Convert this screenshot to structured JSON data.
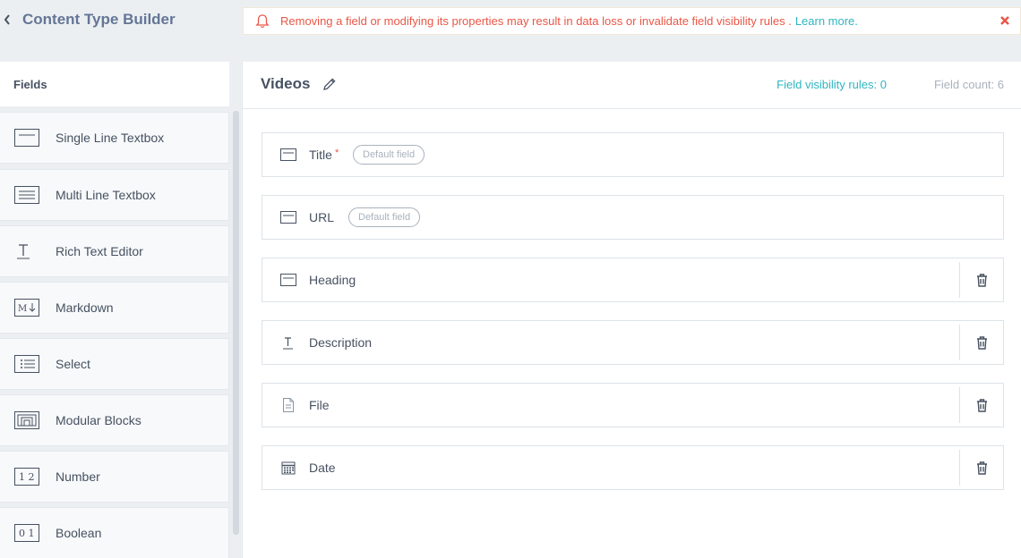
{
  "header": {
    "title": "Content Type Builder"
  },
  "alert": {
    "message": "Removing a field or modifying its properties may result in data loss or invalidate field visibility rules .",
    "link_label": "Learn more."
  },
  "sidebar": {
    "title": "Fields",
    "field_types": [
      {
        "label": "Single Line Textbox",
        "icon": "single-line-icon"
      },
      {
        "label": "Multi Line Textbox",
        "icon": "multi-line-icon"
      },
      {
        "label": "Rich Text Editor",
        "icon": "rich-text-icon"
      },
      {
        "label": "Markdown",
        "icon": "markdown-icon"
      },
      {
        "label": "Select",
        "icon": "select-list-icon"
      },
      {
        "label": "Modular Blocks",
        "icon": "modular-blocks-icon"
      },
      {
        "label": "Number",
        "icon": "number-icon"
      },
      {
        "label": "Boolean",
        "icon": "boolean-icon"
      }
    ]
  },
  "main": {
    "content_type_name": "Videos",
    "visibility_rules": "Field visibility rules: 0",
    "field_count": "Field count: 6",
    "fields": [
      {
        "label": "Title",
        "required_mark": "*",
        "badge": "Default field",
        "icon": "single-line-icon"
      },
      {
        "label": "URL",
        "badge": "Default field",
        "icon": "single-line-icon"
      },
      {
        "label": "Heading",
        "icon": "single-line-icon"
      },
      {
        "label": "Description",
        "icon": "rich-text-icon"
      },
      {
        "label": "File",
        "icon": "file-icon"
      },
      {
        "label": "Date",
        "icon": "calendar-icon"
      }
    ]
  },
  "colors": {
    "accent": "#2fb5c0",
    "danger": "#eb5646",
    "text": "#475161",
    "muted": "#a9b2bc"
  }
}
